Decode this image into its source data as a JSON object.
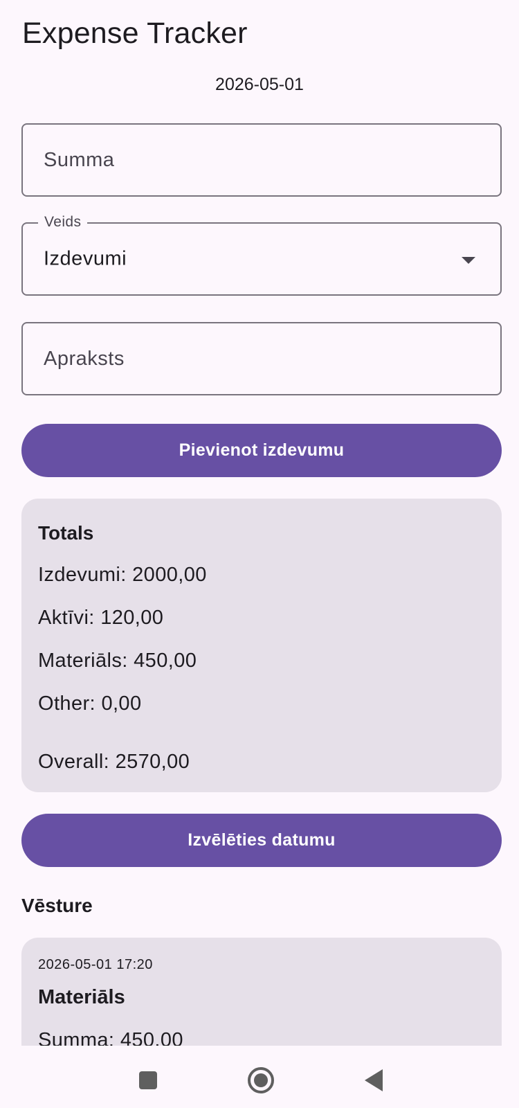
{
  "app": {
    "title": "Expense Tracker",
    "current_date": "2026-05-01"
  },
  "form": {
    "amount_placeholder": "Summa",
    "type_label": "Veids",
    "type_value": "Izdevumi",
    "description_placeholder": "Apraksts",
    "add_button_label": "Pievienot izdevumu"
  },
  "totals": {
    "title": "Totals",
    "expenses": "Izdevumi: 2000,00",
    "assets": "Aktīvi: 120,00",
    "materials": "Materiāls: 450,00",
    "other": "Other: 0,00",
    "overall": "Overall: 2570,00"
  },
  "date_picker": {
    "button_label": "Izvēlēties datumu"
  },
  "history": {
    "title": "Vēsture",
    "entries": [
      {
        "timestamp": "2026-05-01 17:20",
        "category": "Materiāls",
        "amount": "Summa: 450.00"
      }
    ]
  },
  "icons": {
    "nav_recents": "square-icon",
    "nav_home": "home-circle-icon",
    "nav_back": "back-triangle-icon"
  },
  "colors": {
    "background": "#fdf7fd",
    "primary": "#6750a4",
    "card": "#e6e0e9",
    "outline": "#79747e"
  }
}
